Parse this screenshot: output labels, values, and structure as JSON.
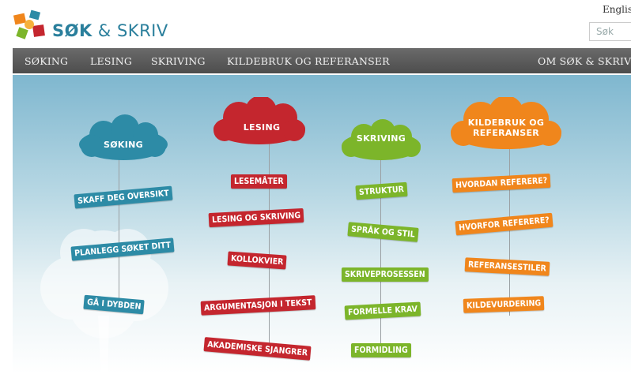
{
  "header": {
    "logo_text_bold": "SØK",
    "logo_text_rest": " & SKRIV",
    "language_link": "English",
    "search_placeholder": "Søk"
  },
  "nav": {
    "items": [
      "SØKING",
      "LESING",
      "SKRIVING",
      "KILDEBRUK OG REFERANSER"
    ],
    "right_item": "OM SØK & SKRIV",
    "background": "#5a5a5a"
  },
  "columns": [
    {
      "title": "SØKING",
      "color": "#2d8ba6",
      "links": [
        "SKAFF DEG OVERSIKT",
        "PLANLEGG SØKET DITT",
        "GÅ I DYBDEN"
      ]
    },
    {
      "title": "LESING",
      "color": "#c4262e",
      "links": [
        "LESEMÅTER",
        "LESING OG SKRIVING",
        "KOLLOKVIER",
        "ARGUMENTASJON I TEKST",
        "AKADEMISKE SJANGRER"
      ]
    },
    {
      "title": "SKRIVING",
      "color": "#7cb52a",
      "links": [
        "STRUKTUR",
        "SPRÅK OG STIL",
        "SKRIVEPROSESSEN",
        "FORMELLE KRAV",
        "FORMIDLING"
      ]
    },
    {
      "title_line1": "KILDEBRUK OG",
      "title_line2": "REFERANSER",
      "color": "#f0861c",
      "links": [
        "HVORDAN REFERERE?",
        "HVORFOR REFERERE?",
        "REFERANSESTILER",
        "KILDEVURDERING"
      ]
    }
  ],
  "icons": {
    "logo": "puzzle-pieces-logo-icon",
    "tree": "tree-illustration-icon"
  }
}
